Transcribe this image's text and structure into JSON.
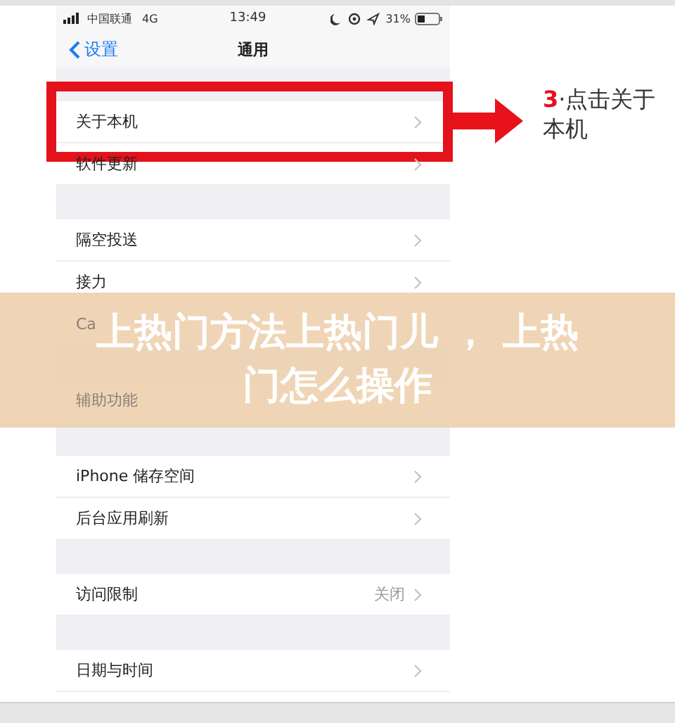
{
  "status_bar": {
    "carrier": "中国联通",
    "network": "4G",
    "time": "13:49",
    "battery": "31%"
  },
  "nav": {
    "back": "设置",
    "title": "通用"
  },
  "sections": [
    {
      "rows": [
        {
          "label": "关于本机",
          "highlighted": true
        },
        {
          "label": "软件更新"
        }
      ]
    },
    {
      "rows": [
        {
          "label": "隔空投送"
        },
        {
          "label": "接力"
        },
        {
          "label": "Ca",
          "chevron": false
        }
      ]
    },
    {
      "rows": [
        {
          "label": "辅助功能",
          "chevron": false
        }
      ]
    },
    {
      "rows": [
        {
          "label": "iPhone 储存空间"
        },
        {
          "label": "后台应用刷新"
        }
      ]
    },
    {
      "rows": [
        {
          "label": "访问限制",
          "value": "关闭"
        }
      ]
    },
    {
      "rows": [
        {
          "label": "日期与时间"
        }
      ]
    }
  ],
  "annotation": {
    "step": "3",
    "text": "·点击关于本机"
  },
  "banner": {
    "title_lines": [
      "上热门方法上热门儿 ， 上热",
      "门怎么操作"
    ]
  }
}
